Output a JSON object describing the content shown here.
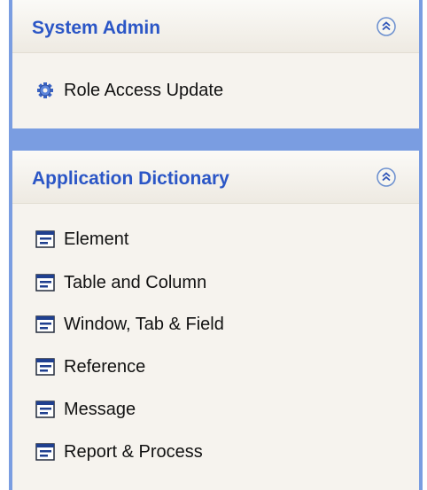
{
  "panels": [
    {
      "title": "System Admin",
      "collapse_icon": "double-chevron-up-icon",
      "items": [
        {
          "label": "Role Access Update",
          "icon": "gear-icon"
        }
      ]
    },
    {
      "title": "Application Dictionary",
      "collapse_icon": "double-chevron-up-icon",
      "items": [
        {
          "label": "Element",
          "icon": "window-icon"
        },
        {
          "label": "Table and Column",
          "icon": "window-icon"
        },
        {
          "label": "Window, Tab & Field",
          "icon": "window-icon"
        },
        {
          "label": "Reference",
          "icon": "window-icon"
        },
        {
          "label": "Message",
          "icon": "window-icon"
        },
        {
          "label": "Report & Process",
          "icon": "window-icon"
        }
      ]
    }
  ],
  "colors": {
    "title": "#2b56c6",
    "panel_background": "#f6f3ee",
    "divider": "#7a9de1"
  }
}
